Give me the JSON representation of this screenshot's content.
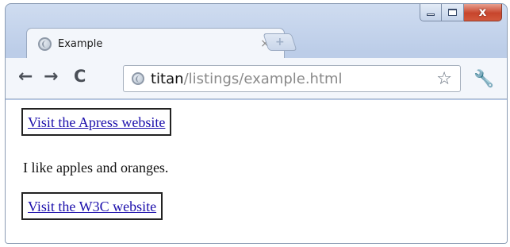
{
  "tab": {
    "title": "Example",
    "close_glyph": "×",
    "new_tab_glyph": "+"
  },
  "window_controls": {
    "minimize": "minimize-icon",
    "maximize": "maximize-icon",
    "close": "close-icon",
    "close_glyph": "x"
  },
  "toolbar": {
    "back_glyph": "←",
    "forward_glyph": "→",
    "reload_glyph": "C",
    "url_host": "titan",
    "url_path": "/listings/example.html",
    "star_glyph": "☆",
    "wrench_glyph": "🔧"
  },
  "content": {
    "link1": "Visit the Apress website",
    "paragraph": "I like apples and oranges.",
    "link2": "Visit the W3C website"
  }
}
